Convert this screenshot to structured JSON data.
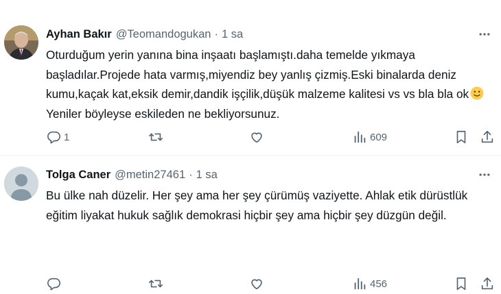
{
  "tweets": [
    {
      "name": "Ayhan Bakır",
      "handle": "@Teomandogukan",
      "separator": "·",
      "time": "1 sa",
      "text_before_emoji": "Oturduğum yerin yanına bina inşaatı başlamıştı.daha temelde yıkmaya başladılar.Projede hata varmış,miyendiz bey yanlış çizmiş.Eski binalarda deniz kumu,kaçak kat,eksik demir,dandik işçilik,düşük malzeme kalitesi vs vs bla bla ok",
      "emoji": "slightly-smiling-face",
      "text_after_emoji": "Yeniler böyleyse eskileden ne bekliyorsunuz.",
      "replies": "1",
      "retweets": "",
      "likes": "",
      "views": "609"
    },
    {
      "name": "Tolga Caner",
      "handle": "@metin27461",
      "separator": "·",
      "time": "1 sa",
      "text": "Bu ülke nah düzelir. Her şey ama her şey çürümüş vaziyette. Ahlak etik dürüstlük eğitim liyakat hukuk sağlık demokrasi hiçbir şey ama hiçbir şey düzgün değil.",
      "replies": "",
      "retweets": "",
      "likes": "",
      "views": "456"
    }
  ],
  "colors": {
    "text": "#0f1419",
    "secondary": "#536471",
    "divider": "#eff3f4",
    "default_avatar": "#cfd9de"
  },
  "icons": [
    "more-icon",
    "reply-icon",
    "retweet-icon",
    "like-icon",
    "views-icon",
    "bookmark-icon",
    "share-icon"
  ]
}
